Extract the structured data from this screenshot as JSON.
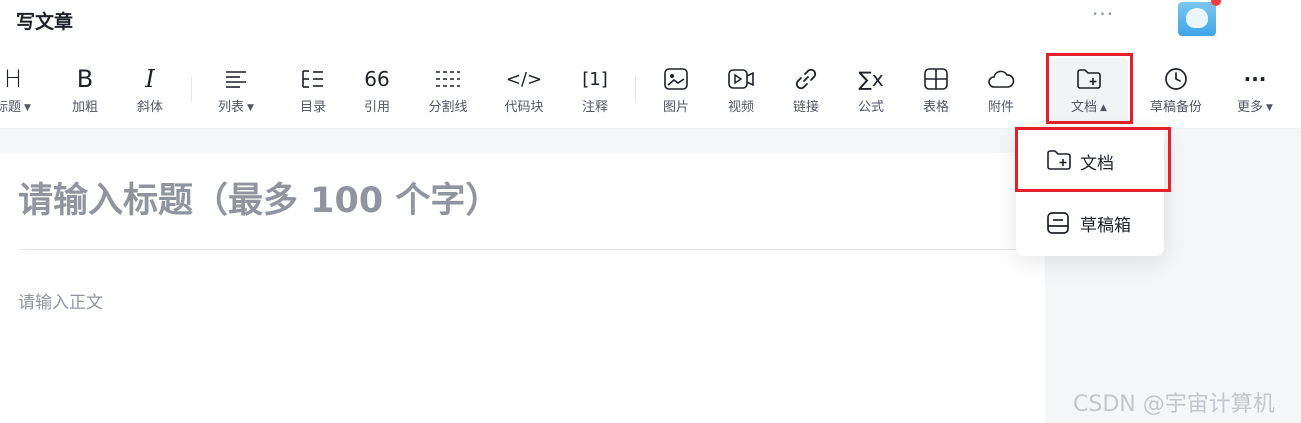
{
  "header": {
    "title": "写文章",
    "more_label": "···",
    "avatar_alt": "avatar"
  },
  "toolbar": {
    "items": [
      {
        "label": "标题",
        "icon": "heading-icon",
        "glyph": "H",
        "has_caret": true
      },
      {
        "label": "加粗",
        "icon": "bold-icon",
        "glyph": "B"
      },
      {
        "label": "斜体",
        "icon": "italic-icon",
        "glyph": "I"
      },
      {
        "label": "列表",
        "icon": "list-icon",
        "has_caret": true
      },
      {
        "label": "目录",
        "icon": "toc-icon"
      },
      {
        "label": "引用",
        "icon": "quote-icon",
        "glyph": "66"
      },
      {
        "label": "分割线",
        "icon": "divider-icon"
      },
      {
        "label": "代码块",
        "icon": "code-block-icon",
        "glyph": "</>"
      },
      {
        "label": "注释",
        "icon": "footnote-icon",
        "glyph": "[1]"
      },
      {
        "label": "图片",
        "icon": "image-icon"
      },
      {
        "label": "视频",
        "icon": "video-icon"
      },
      {
        "label": "链接",
        "icon": "link-icon"
      },
      {
        "label": "公式",
        "icon": "formula-icon",
        "glyph": "∑x"
      },
      {
        "label": "表格",
        "icon": "table-icon"
      },
      {
        "label": "附件",
        "icon": "attachment-cloud-icon"
      },
      {
        "label": "文档",
        "icon": "folder-add-icon",
        "has_caret": true,
        "active": true
      },
      {
        "label": "草稿备份",
        "icon": "clock-icon"
      },
      {
        "label": "更多",
        "icon": "more-icon",
        "glyph": "···",
        "has_caret": true
      }
    ]
  },
  "editor": {
    "title_placeholder": "请输入标题（最多 100 个字）",
    "body_placeholder": "请输入正文"
  },
  "dropdown": {
    "items": [
      {
        "label": "文档",
        "icon": "folder-add-icon"
      },
      {
        "label": "草稿箱",
        "icon": "drafts-box-icon"
      }
    ]
  },
  "watermark": "CSDN @宇宙计算机",
  "colors": {
    "highlight_box": "#e5202a",
    "placeholder": "#8f949e",
    "toolbar_bg": "#ffffff",
    "page_bg": "#f5f6f7"
  }
}
